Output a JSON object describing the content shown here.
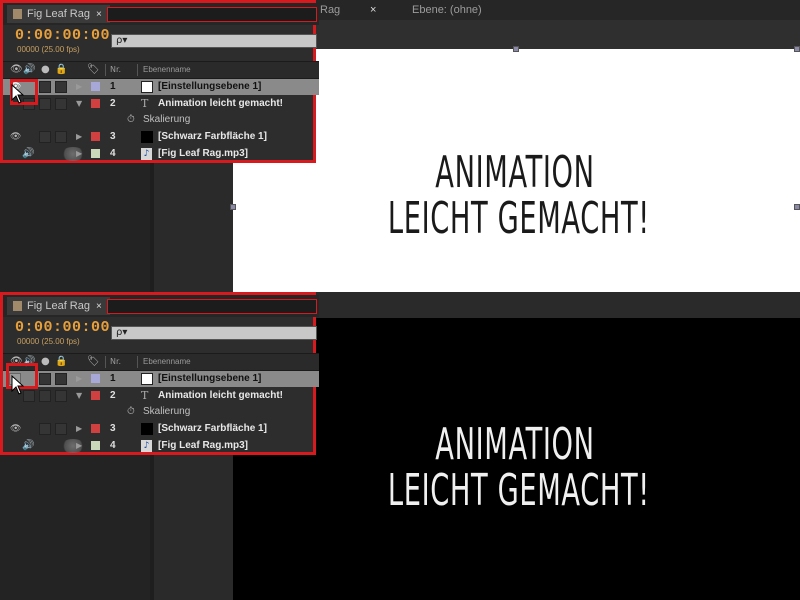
{
  "panel": {
    "tab_label": "Fig Leaf Rag",
    "tab_close": "×",
    "timecode": "0:00:00:00",
    "fps": "00000 (25.00 fps)",
    "search_placeholder": "ρ▾",
    "header": {
      "nr": "Nr.",
      "name": "Ebenenname"
    },
    "layers": [
      {
        "num": "1",
        "name": "[Einstellungsebene 1]",
        "label_color": "#a8a8d8",
        "swatch": "#ffffff"
      },
      {
        "num": "2",
        "name": "Animation leicht gemacht!",
        "label_color": "#d04040",
        "swatch": "text"
      },
      {
        "num": "",
        "name": "Skalierung"
      },
      {
        "num": "3",
        "name": "[Schwarz Farbfläche 1]",
        "label_color": "#d04040",
        "swatch": "#000000"
      },
      {
        "num": "4",
        "name": "[Fig Leaf Rag.mp3]",
        "label_color": "#c8d8b8",
        "swatch": "audio"
      }
    ]
  },
  "comp": {
    "tab_partial": "Rag",
    "tab_close": "×",
    "layer_tab": "Ebene: (ohne)",
    "title_line1": "ANIMATION",
    "title_line2": "LEICHT GEMACHT!"
  },
  "colors": {
    "highlight": "#d8191e",
    "timecode": "#e8a03a",
    "stage_top": "#ffffff",
    "stage_bottom": "#000000"
  }
}
